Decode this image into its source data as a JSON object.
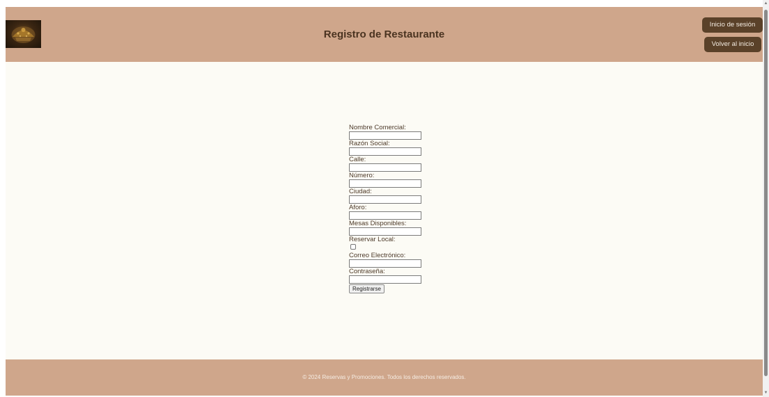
{
  "header": {
    "title": "Registro de Restaurante",
    "logo_icon": "restaurant-logo-icon",
    "buttons": {
      "login": "Inicio de sesión",
      "home": "Volver al inicio"
    }
  },
  "form": {
    "fields": [
      {
        "label": "Nombre Comercial:",
        "type": "text",
        "value": ""
      },
      {
        "label": "Razón Social:",
        "type": "text",
        "value": ""
      },
      {
        "label": "Calle:",
        "type": "text",
        "value": ""
      },
      {
        "label": "Número:",
        "type": "text",
        "value": ""
      },
      {
        "label": "Ciudad:",
        "type": "text",
        "value": ""
      },
      {
        "label": "Aforo:",
        "type": "text",
        "value": ""
      },
      {
        "label": "Mesas Disponibles:",
        "type": "text",
        "value": ""
      },
      {
        "label": "Reservar Local:",
        "type": "checkbox",
        "checked": false
      },
      {
        "label": "Correo Electrónico:",
        "type": "text",
        "value": ""
      },
      {
        "label": "Contraseña:",
        "type": "password",
        "value": ""
      }
    ],
    "submit_label": "Registrarse"
  },
  "footer": {
    "text": "© 2024 Reservas y Promociones. Todos los derechos reservados."
  },
  "colors": {
    "header_bg": "#cfa68b",
    "page_bg": "#fcfbf5",
    "button_bg": "#5a4129",
    "title_text": "#4a3320"
  }
}
